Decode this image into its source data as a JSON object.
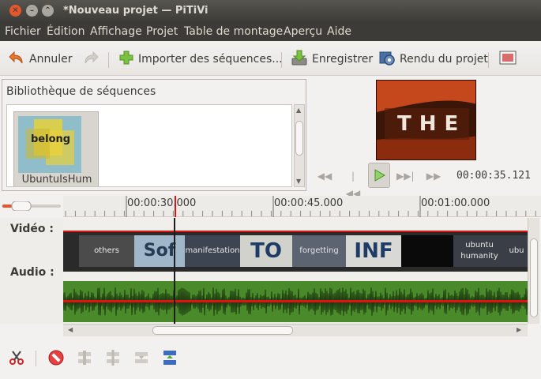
{
  "window": {
    "title": "*Nouveau projet — PiTiVi",
    "close_glyph": "✕",
    "minimize_glyph": "–",
    "maximize_glyph": "⌃"
  },
  "menubar": {
    "items": [
      "Fichier",
      "Édition",
      "Affichage",
      "Projet",
      "Table de montage",
      "Aperçu",
      "Aide"
    ]
  },
  "toolbar": {
    "undo_label": "Annuler",
    "import_label": "Importer des séquences...",
    "save_label": "Enregistrer",
    "render_label": "Rendu du projet",
    "undo_icon": "undo-arrow-icon",
    "redo_icon": "redo-arrow-icon",
    "import_icon": "plus-icon",
    "save_icon": "save-download-icon",
    "render_icon": "gear-film-icon",
    "fullscreen_icon": "fullscreen-icon"
  },
  "library": {
    "title": "Bibliothèque de séquences",
    "clips": [
      {
        "label": "UbuntuIsHum",
        "thumb_text": "belong"
      }
    ]
  },
  "viewer": {
    "frame_text": "THE",
    "timecode": "00:00:35.121"
  },
  "ruler": {
    "labels": [
      "00:00:30.000",
      "00:00:45.000",
      "00:01:00.000"
    ]
  },
  "tracks": {
    "video_label": "Vidéo :",
    "audio_label": "Audio :",
    "video_thumbs": [
      "others",
      "Sof",
      "manifestation",
      "TO",
      "forgetting",
      "INF",
      "",
      "ubuntu humanity",
      "ubu"
    ]
  },
  "colors": {
    "accent_red": "#e31212",
    "audio_green": "#4a8a2a",
    "close_orange": "#e4572c"
  }
}
